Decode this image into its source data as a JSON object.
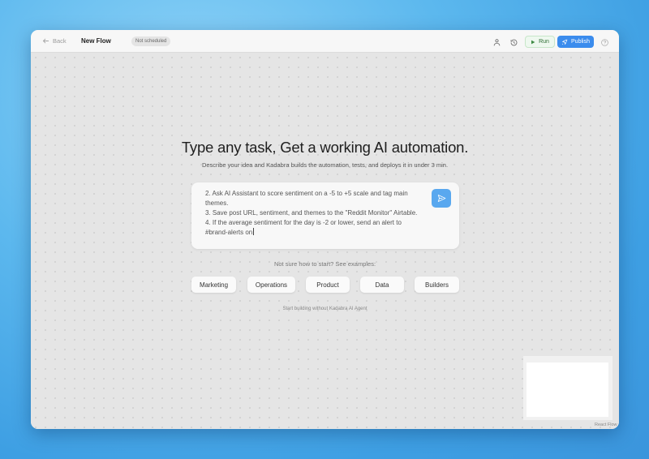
{
  "topbar": {
    "back_label": "Back",
    "flow_title": "New Flow",
    "schedule_badge": "Not scheduled",
    "run_label": "Run",
    "publish_label": "Publish"
  },
  "main": {
    "headline": "Type any task, Get a working AI automation.",
    "subline": "Describe your idea and Kadabra builds the automation, tests, and deploys it in under 3 min.",
    "prompt_text": "2. Ask AI Assistant to score sentiment on a -5 to +5 scale and tag main themes.\n3. Save post URL, sentiment, and themes to the \"Reddit Monitor\" Airtable.\n4. If the average sentiment for the day is -2 or lower, send an alert to #brand-alerts on",
    "examples_label": "Not sure how to start? See examples:",
    "examples": [
      "Marketing",
      "Operations",
      "Product",
      "Data",
      "Builders"
    ],
    "no_agent_link": "Start building without Kadabra AI Agent"
  },
  "footer": {
    "attribution": "React Flow"
  },
  "colors": {
    "accent": "#3b8ced",
    "run_green": "#2f6d34",
    "canvas": "#e5e5e5"
  },
  "icons": {
    "back": "arrow-left-icon",
    "share": "users-icon",
    "history": "history-icon",
    "run": "play-icon",
    "publish": "rocket-icon",
    "help": "help-circle-icon",
    "send": "send-icon"
  }
}
